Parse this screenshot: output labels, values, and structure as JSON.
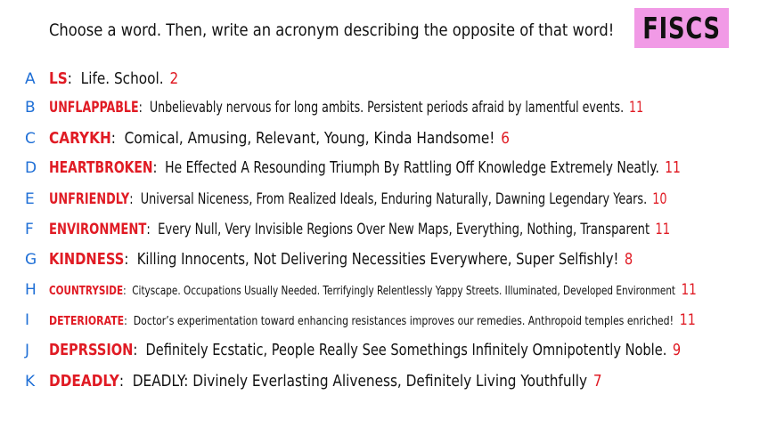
{
  "header": {
    "prompt": "Choose a word. Then, write an acronym describing the opposite of that word!",
    "badge": "FISCS"
  },
  "colors": {
    "badge_bg": "#f19ae6",
    "letter": "#1f6fd6",
    "word": "#e01b24",
    "score": "#e01b24",
    "text": "#111111"
  },
  "entries": [
    {
      "letter": "A",
      "word": "LS",
      "acronym": "Life. School.",
      "score": "2"
    },
    {
      "letter": "B",
      "word": "UNFLAPPABLE",
      "acronym": "Unbelievably nervous for long ambits. Persistent periods afraid by lamentful events.",
      "score": "11"
    },
    {
      "letter": "C",
      "word": "CARYKH",
      "acronym": "Comical, Amusing, Relevant, Young, Kinda Handsome!",
      "score": "6"
    },
    {
      "letter": "D",
      "word": "HEARTBROKEN",
      "acronym": "He Effected A Resounding Triumph By Rattling Off Knowledge Extremely Neatly.",
      "score": "11"
    },
    {
      "letter": "E",
      "word": "UNFRIENDLY",
      "acronym": "Universal Niceness, From Realized Ideals, Enduring Naturally, Dawning Legendary Years.",
      "score": "10"
    },
    {
      "letter": "F",
      "word": "ENVIRONMENT",
      "acronym": "Every Null, Very Invisible Regions Over New Maps, Everything, Nothing, Transparent",
      "score": "11"
    },
    {
      "letter": "G",
      "word": "KINDNESS",
      "acronym": "Killing Innocents, Not Delivering Necessities Everywhere, Super Selfishly!",
      "score": "8"
    },
    {
      "letter": "H",
      "word": "COUNTRYSIDE",
      "acronym": "Cityscape. Occupations Usually Needed. Terrifyingly Relentlessly Yappy Streets. Illuminated, Developed Environment",
      "score": "11"
    },
    {
      "letter": "I",
      "word": "DETERIORATE",
      "acronym": "Doctor’s experimentation toward enhancing resistances improves our remedies. Anthropoid temples enriched!",
      "score": "11"
    },
    {
      "letter": "J",
      "word": "DEPRSSION",
      "acronym": "Definitely Ecstatic, People Really See Somethings Infinitely Omnipotently Noble.",
      "score": "9"
    },
    {
      "letter": "K",
      "word": "DDEADLY",
      "acronym": "DEADLY: Divinely Everlasting Aliveness, Definitely Living Youthfully",
      "score": "7"
    }
  ]
}
